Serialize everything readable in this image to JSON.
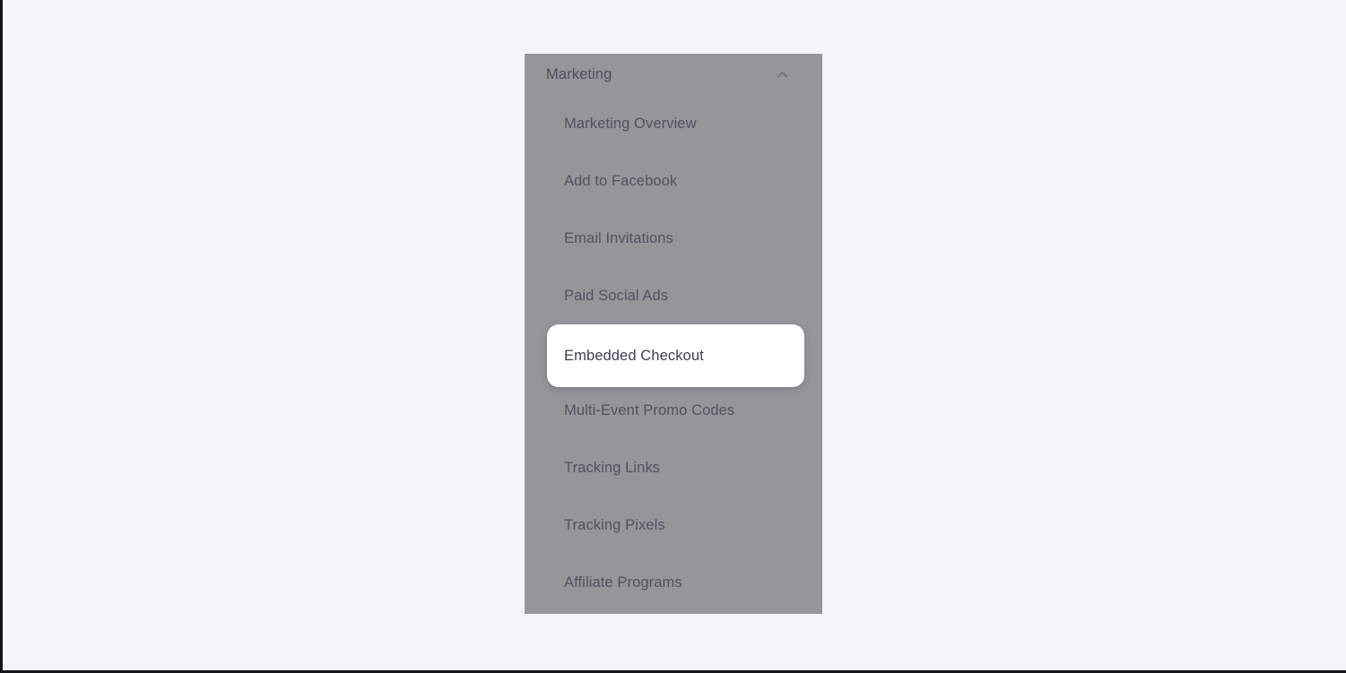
{
  "page": {
    "background_color": "#f4f5f7",
    "border_color": "#111418"
  },
  "nav_panel": {
    "overlay_color": "#949699",
    "section": {
      "title": "Marketing",
      "collapse_icon": "chevron-up-icon",
      "expanded": true
    },
    "items": [
      {
        "label": "Marketing Overview",
        "highlighted": false
      },
      {
        "label": "Add to Facebook",
        "highlighted": false
      },
      {
        "label": "Email Invitations",
        "highlighted": false
      },
      {
        "label": "Paid Social Ads",
        "highlighted": false
      },
      {
        "label": "Embedded Checkout",
        "highlighted": true
      },
      {
        "label": "Multi-Event Promo Codes",
        "highlighted": false
      },
      {
        "label": "Tracking Links",
        "highlighted": false
      },
      {
        "label": "Tracking Pixels",
        "highlighted": false
      },
      {
        "label": "Affiliate Programs",
        "highlighted": false
      }
    ],
    "highlight": {
      "label": "Embedded Checkout",
      "card_color": "#ffffff",
      "text_color": "#3c4051"
    }
  }
}
